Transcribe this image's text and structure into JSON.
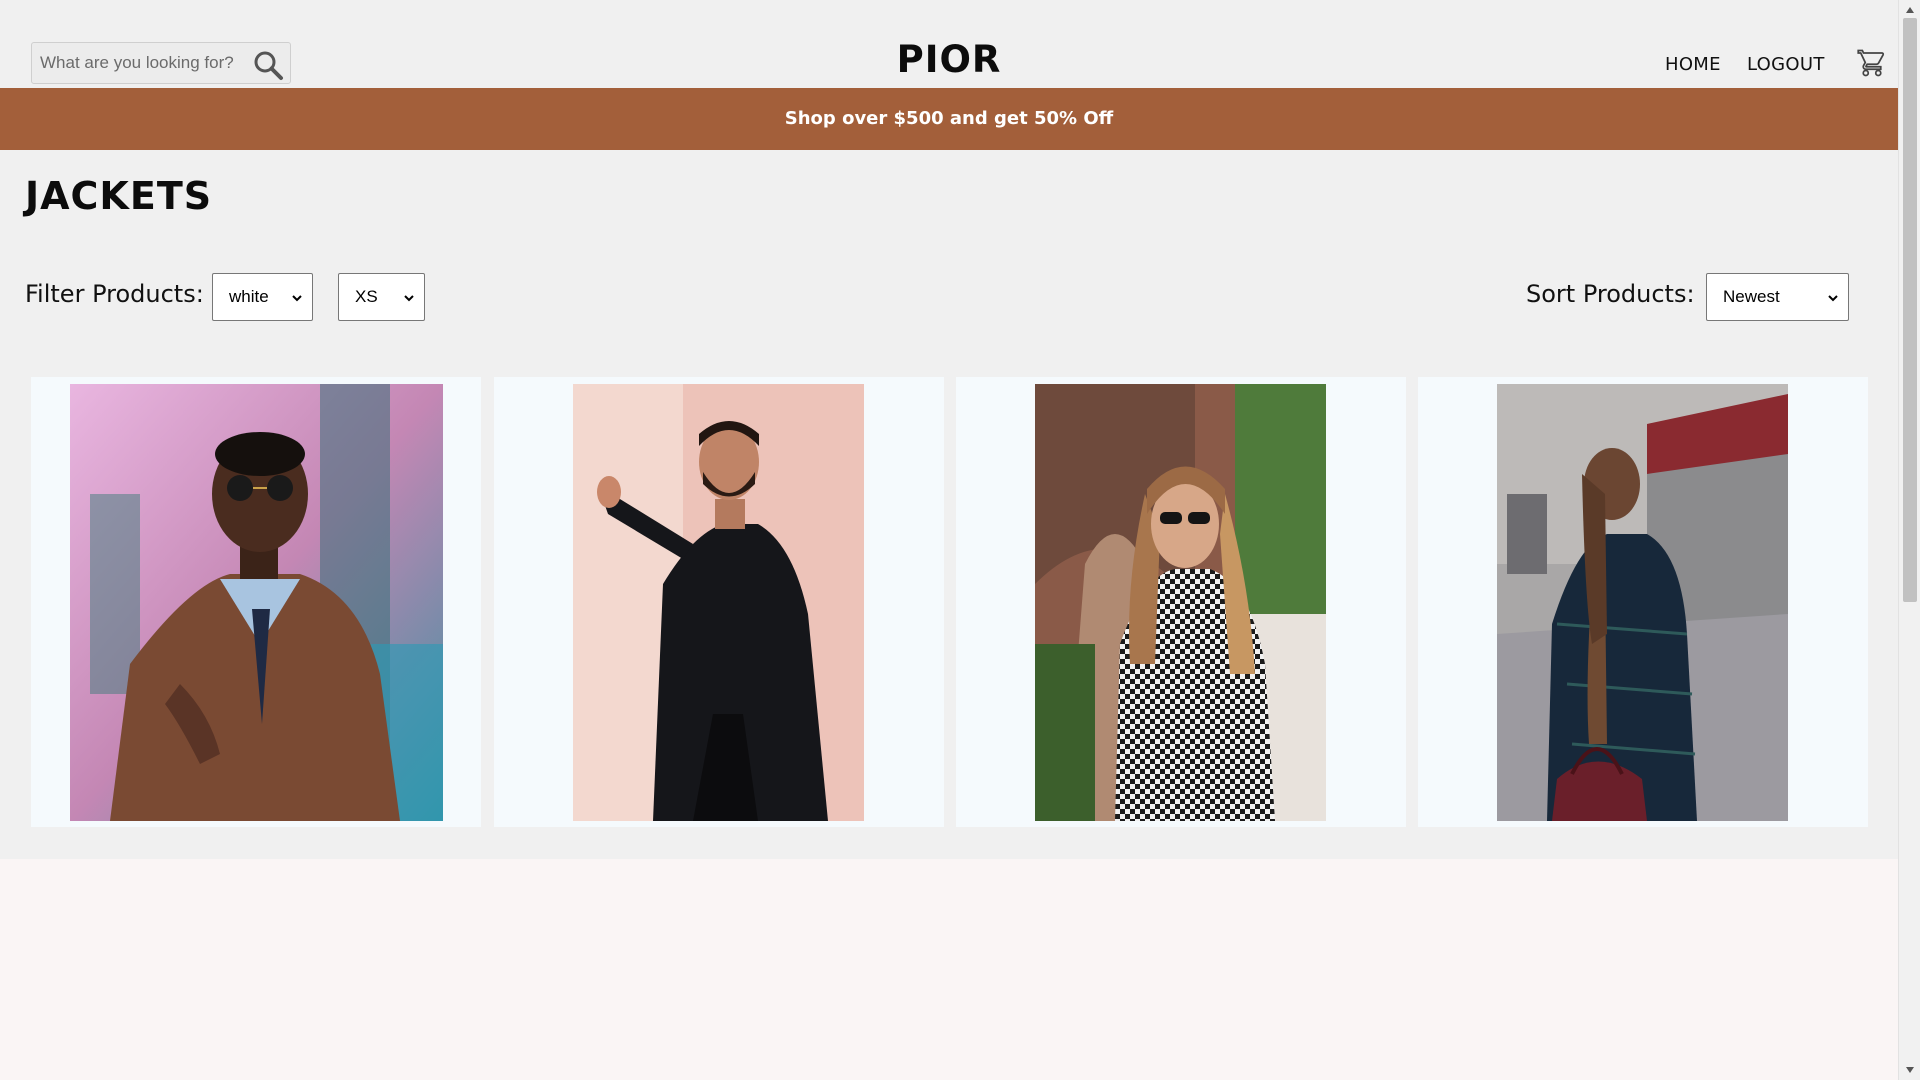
{
  "header": {
    "search": {
      "placeholder": "What are you looking for?",
      "value": ""
    },
    "brand": "PIOR",
    "nav": {
      "home": "HOME",
      "logout": "LOGOUT"
    },
    "icons": {
      "search": "search-icon",
      "cart": "cart-icon"
    }
  },
  "announcement": {
    "text": "Shop over $500 and get 50% Off",
    "background": "#a35f3a"
  },
  "page": {
    "title": "JACKETS"
  },
  "filters": {
    "label": "Filter Products:",
    "color": {
      "selected": "white"
    },
    "size": {
      "selected": "XS"
    }
  },
  "sort": {
    "label": "Sort Products:",
    "selected": "Newest"
  },
  "products": [
    {
      "image": "man in brown leather jacket with sunglasses"
    },
    {
      "image": "bearded man in black coat leaning on pink wall"
    },
    {
      "image": "woman in houndstooth coat with sunglasses"
    },
    {
      "image": "woman in dark plaid blazer with red handbag"
    }
  ],
  "colors": {
    "accent": "#a35f3a",
    "page_bg": "#f0f0f0",
    "card_bg": "#f5fafd",
    "footer_bg": "#faf5f5"
  }
}
